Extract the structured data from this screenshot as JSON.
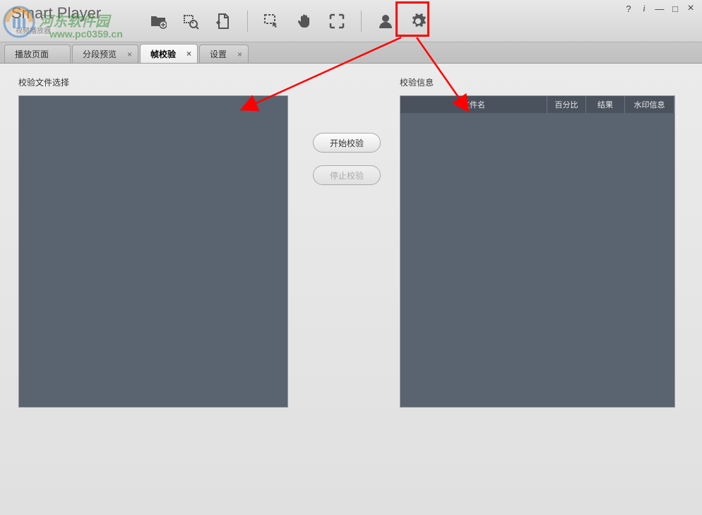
{
  "app": {
    "title": "Smart Player",
    "subtitle": "视频播放器"
  },
  "watermark": {
    "text1": "河东软件园",
    "text2": "www.pc0359.cn"
  },
  "window_controls": {
    "help": "?",
    "info": "i",
    "min": "—",
    "max": "□",
    "close": "×"
  },
  "tabs": [
    {
      "label": "播放页面",
      "closable": false,
      "active": false
    },
    {
      "label": "分段预览",
      "closable": true,
      "active": false
    },
    {
      "label": "帧校验",
      "closable": true,
      "active": true
    },
    {
      "label": "设置",
      "closable": true,
      "active": false
    }
  ],
  "panels": {
    "left_label": "校验文件选择",
    "right_label": "校验信息"
  },
  "buttons": {
    "start": "开始校验",
    "stop": "停止校验"
  },
  "table_headers": {
    "filename": "文件名",
    "percent": "百分比",
    "result": "结果",
    "watermark": "水印信息"
  },
  "toolbar_icons": [
    "folder-add-icon",
    "zoom-icon",
    "document-export-icon",
    "select-region-icon",
    "hand-pan-icon",
    "fullscreen-icon",
    "user-icon",
    "gear-icon"
  ]
}
